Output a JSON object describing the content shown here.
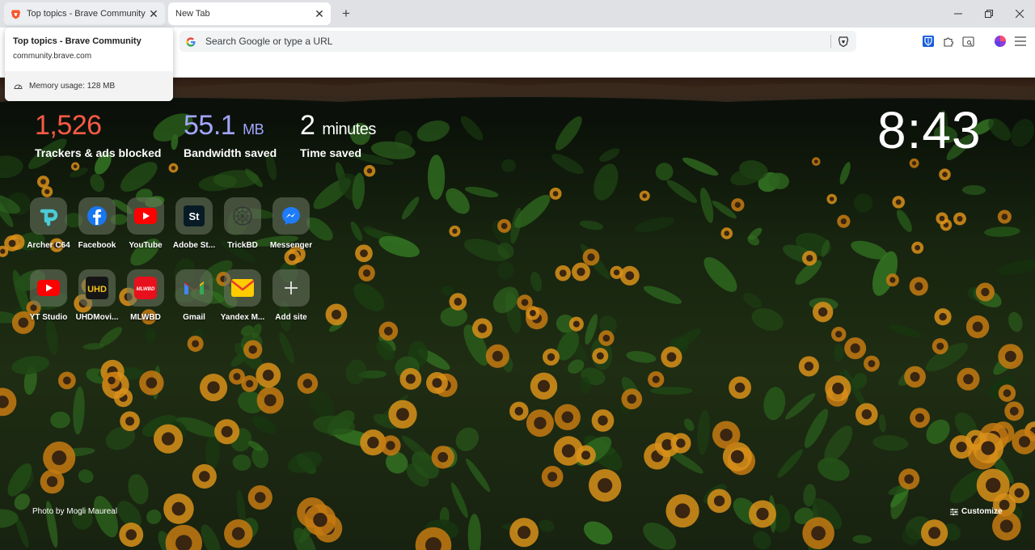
{
  "tabs": [
    {
      "title": "Top topics - Brave Community"
    },
    {
      "title": "New Tab"
    }
  ],
  "hovercard": {
    "title": "Top topics - Brave Community",
    "url": "community.brave.com",
    "memory": "Memory usage: 128 MB"
  },
  "omnibox": {
    "placeholder": "Search Google or type a URL",
    "value": ""
  },
  "stats": {
    "trackers": {
      "value": "1,526",
      "label": "Trackers & ads blocked",
      "color": "#fb5a45"
    },
    "bandwidth": {
      "value": "55.1",
      "unit": "MB",
      "label": "Bandwidth saved",
      "color": "#a3a6ff"
    },
    "time": {
      "value": "2",
      "unit": "minutes",
      "label": "Time saved"
    }
  },
  "clock": "8:43",
  "tiles_row1": [
    {
      "label": "Archer C64",
      "icon": "tplink-icon"
    },
    {
      "label": "Facebook",
      "icon": "facebook-icon"
    },
    {
      "label": "YouTube",
      "icon": "youtube-icon"
    },
    {
      "label": "Adobe St...",
      "icon": "adobe-stock-icon"
    },
    {
      "label": "TrickBD",
      "icon": "trickbd-icon"
    },
    {
      "label": "Messenger",
      "icon": "messenger-icon"
    }
  ],
  "tiles_row2": [
    {
      "label": "YT Studio",
      "icon": "yt-studio-icon"
    },
    {
      "label": "UHDMovi...",
      "icon": "uhdmovies-icon"
    },
    {
      "label": "MLWBD",
      "icon": "mlwbd-icon"
    },
    {
      "label": "Gmail",
      "icon": "gmail-icon"
    },
    {
      "label": "Yandex M...",
      "icon": "yandex-mail-icon"
    },
    {
      "label": "Add site",
      "icon": "plus-icon"
    }
  ],
  "tile_icon_text": {
    "stock": "St",
    "mlwbd": "MLWBD",
    "uhd": "UHD"
  },
  "footer": {
    "credit": "Photo by Mogli Maureal",
    "customize": "Customize"
  }
}
